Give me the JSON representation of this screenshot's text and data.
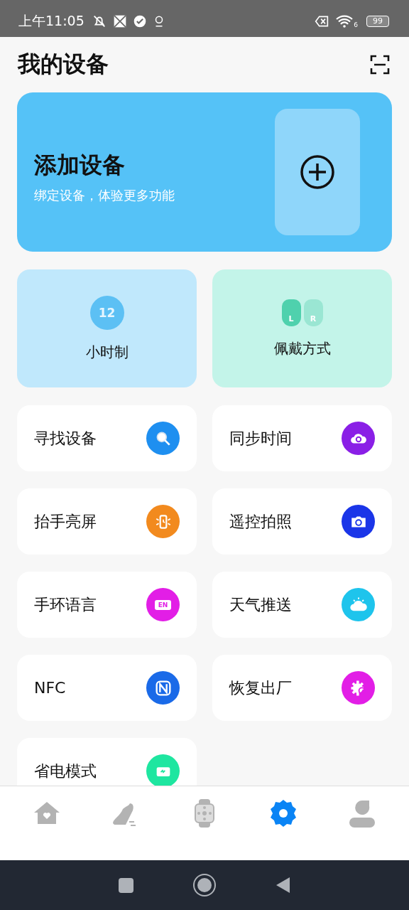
{
  "status_bar": {
    "time": "上午11:05",
    "wifi_text": "6",
    "battery": "99"
  },
  "header": {
    "title": "我的设备"
  },
  "add_card": {
    "title": "添加设备",
    "subtitle": "绑定设备，体验更多功能"
  },
  "tiles": [
    {
      "label": "小时制",
      "kind": "clock",
      "icon_text": [
        "12"
      ]
    },
    {
      "label": "佩戴方式",
      "kind": "hands",
      "icon_text": [
        "L",
        "R"
      ]
    }
  ],
  "features": [
    {
      "label": "寻找设备",
      "kind": "search",
      "color": "#1e8ff0"
    },
    {
      "label": "同步时间",
      "kind": "sync",
      "color": "#8a1fe6"
    },
    {
      "label": "抬手亮屏",
      "kind": "watch",
      "color": "#f28a1e"
    },
    {
      "label": "遥控拍照",
      "kind": "camera",
      "color": "#1a35e8"
    },
    {
      "label": "手环语言",
      "kind": "language",
      "color": "#e21ee6",
      "icon_text": "EN"
    },
    {
      "label": "天气推送",
      "kind": "weather",
      "color": "#1ec4ec"
    },
    {
      "label": "NFC",
      "kind": "nfc",
      "color": "#1a6ae8"
    },
    {
      "label": "恢复出厂",
      "kind": "reset",
      "color": "#e21ee6"
    },
    {
      "label": "省电模式",
      "kind": "battery",
      "color": "#1ee6a0"
    }
  ],
  "nav": [
    {
      "kind": "home",
      "selected": false
    },
    {
      "kind": "shoe",
      "selected": false
    },
    {
      "kind": "watch",
      "selected": false
    },
    {
      "kind": "gear",
      "selected": true
    },
    {
      "kind": "person",
      "selected": false
    }
  ]
}
